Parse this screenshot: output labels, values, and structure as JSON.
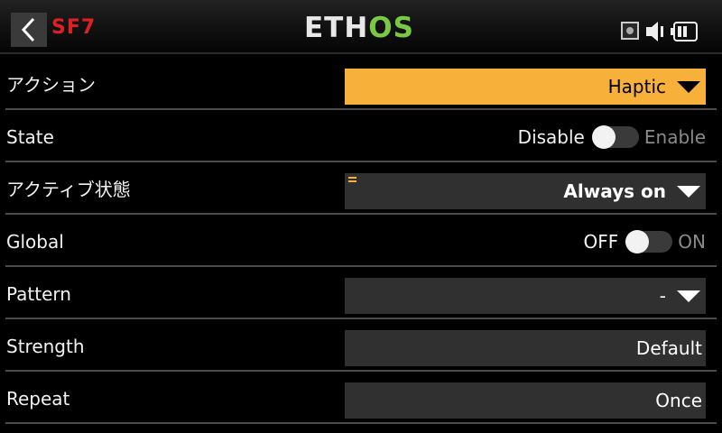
{
  "header": {
    "screen_id": "SF7",
    "logo_part1": "ETH",
    "logo_part2": "OS"
  },
  "rows": [
    {
      "label": "アクション",
      "value": "Haptic"
    },
    {
      "label": "State",
      "off_label": "Disable",
      "on_label": "Enable"
    },
    {
      "label": "アクティブ状態",
      "value": "Always on"
    },
    {
      "label": "Global",
      "off_label": "OFF",
      "on_label": "ON"
    },
    {
      "label": "Pattern",
      "value": "-"
    },
    {
      "label": "Strength",
      "value": "Default"
    },
    {
      "label": "Repeat",
      "value": "Once"
    }
  ],
  "colors": {
    "accent": "#f7b03a",
    "logo_green": "#7ac943",
    "screen_id": "#e02020"
  },
  "icons": [
    "back-arrow-icon",
    "record-icon",
    "speaker-icon",
    "battery-icon",
    "menu-icon",
    "dropdown-arrow-icon"
  ]
}
